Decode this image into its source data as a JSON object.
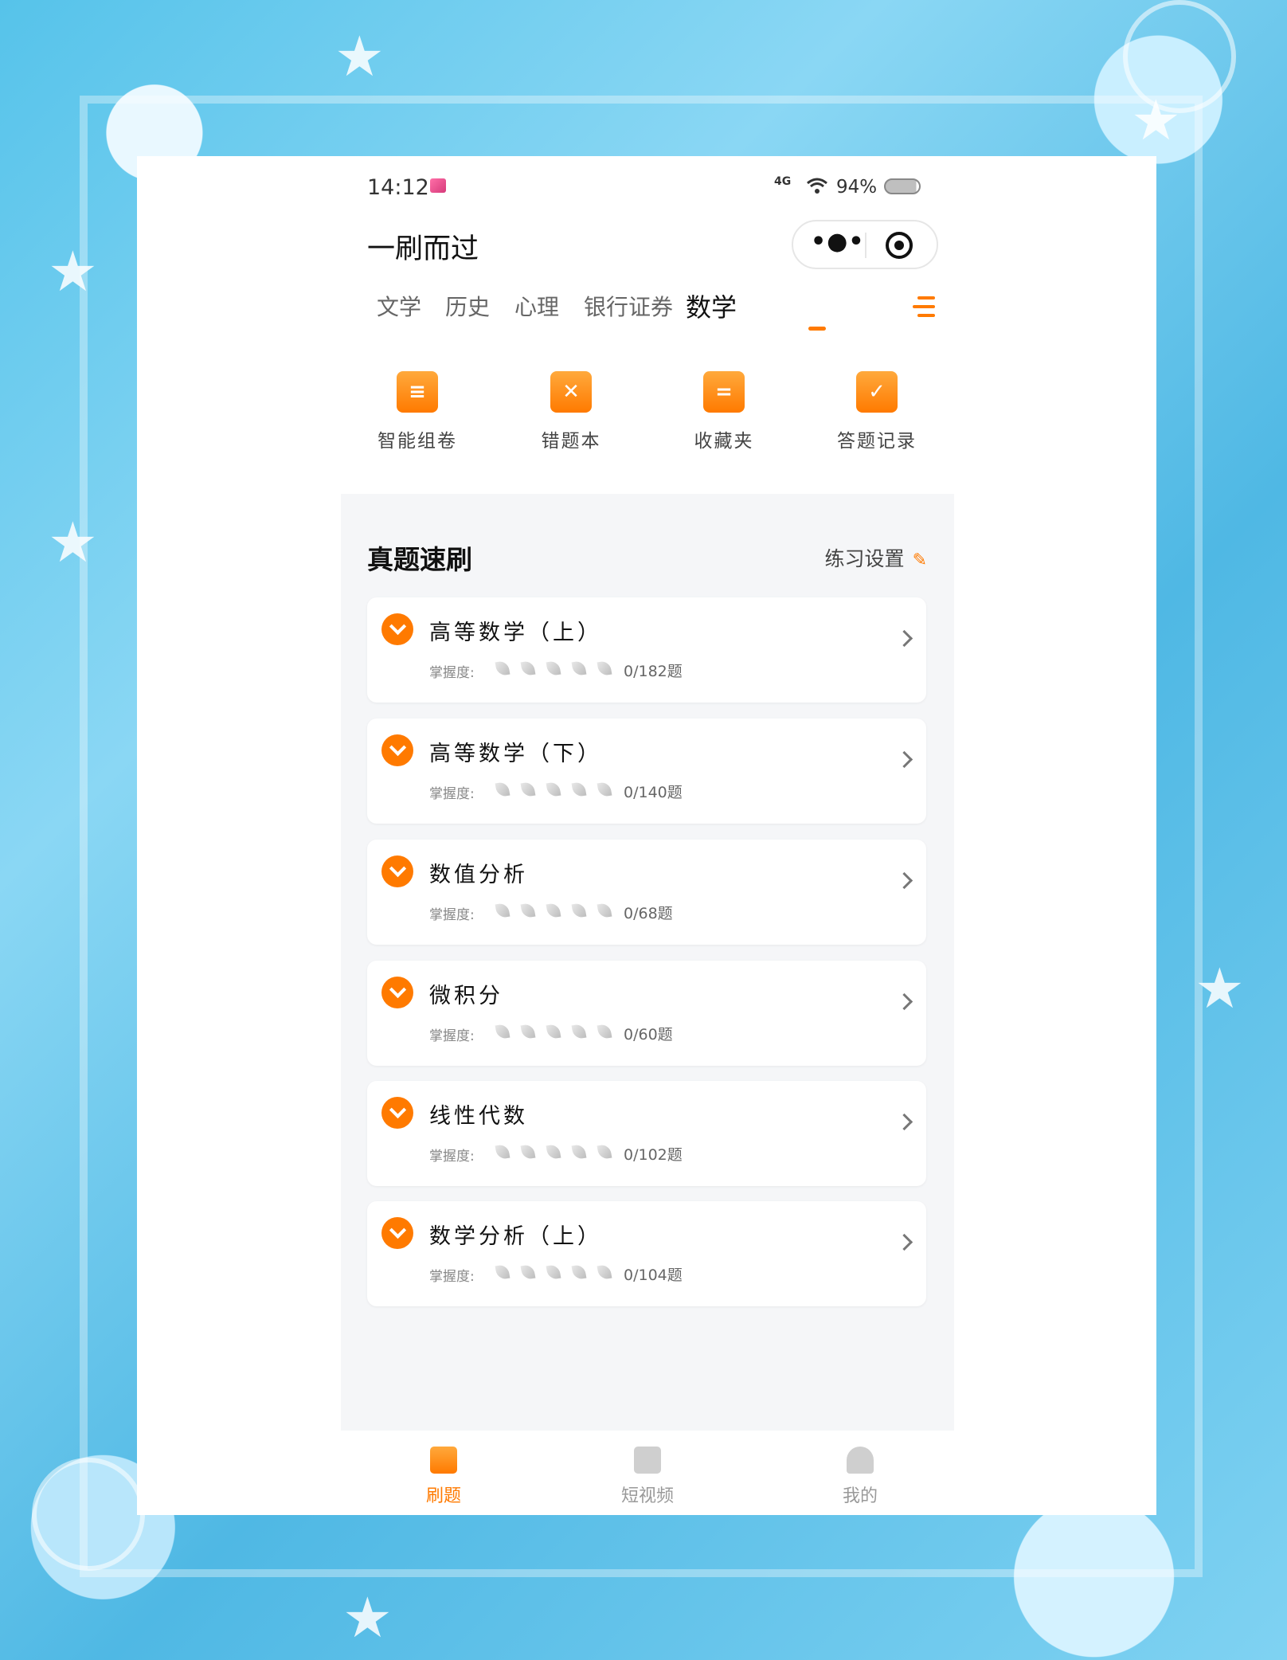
{
  "status_bar": {
    "time": "14:12",
    "network": "4G",
    "battery": "94%"
  },
  "header": {
    "title": "一刷而过"
  },
  "tabs": [
    {
      "label": "文学"
    },
    {
      "label": "历史"
    },
    {
      "label": "心理"
    },
    {
      "label": "银行证券"
    },
    {
      "label": "数学",
      "active": true
    }
  ],
  "quick_actions": [
    {
      "label": "智能组卷",
      "icon": "document-icon"
    },
    {
      "label": "错题本",
      "icon": "wrong-book-icon"
    },
    {
      "label": "收藏夹",
      "icon": "folder-icon"
    },
    {
      "label": "答题记录",
      "icon": "calendar-check-icon"
    }
  ],
  "practice": {
    "title": "真题速刷",
    "settings_label": "练习设置",
    "mastery_label": "掌握度:",
    "items": [
      {
        "name": "高等数学（上）",
        "count": "0/182题"
      },
      {
        "name": "高等数学（下）",
        "count": "0/140题"
      },
      {
        "name": "数值分析",
        "count": "0/68题"
      },
      {
        "name": "微积分",
        "count": "0/60题"
      },
      {
        "name": "线性代数",
        "count": "0/102题"
      },
      {
        "name": "数学分析（上）",
        "count": "0/104题"
      }
    ]
  },
  "bottom_nav": [
    {
      "label": "刷题",
      "active": true
    },
    {
      "label": "短视频"
    },
    {
      "label": "我的"
    }
  ],
  "colors": {
    "accent": "#ff7a00",
    "section_bg": "#f5f6f8"
  }
}
